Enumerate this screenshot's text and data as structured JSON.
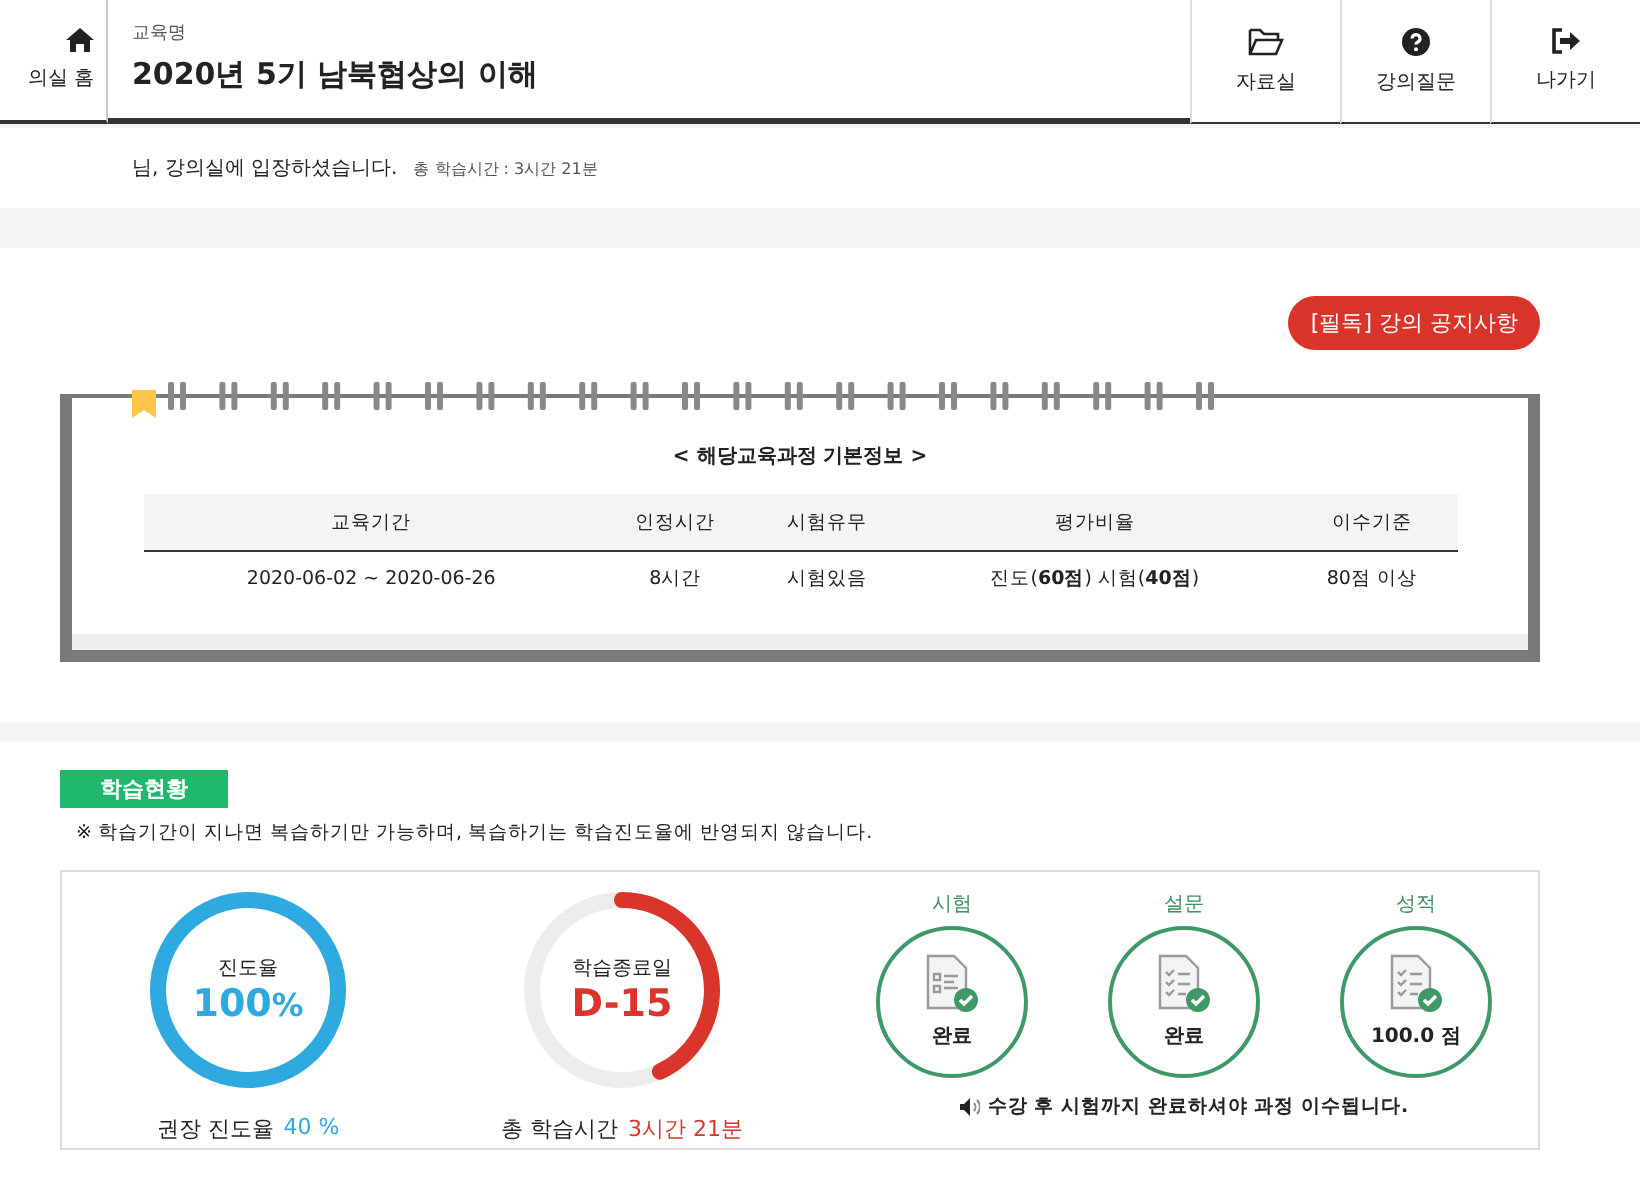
{
  "header": {
    "home": "의실 홈",
    "caption": "교육명",
    "title": "2020년 5기 남북협상의 이해",
    "actions": [
      {
        "kind": "folder",
        "label": "자료실"
      },
      {
        "kind": "question",
        "label": "강의질문"
      },
      {
        "kind": "exit",
        "label": "나가기"
      }
    ]
  },
  "welcome": {
    "message": "님, 강의실에 입장하셨습니다.",
    "time": "총 학습시간 : 3시간 21분"
  },
  "notice_button": "[필독] 강의 공지사항",
  "course_info": {
    "title": "< 해당교육과정 기본정보 >",
    "columns": [
      "교육기간",
      "인정시간",
      "시험유무",
      "평가비율",
      "이수기준"
    ],
    "rows": [
      [
        "2020-06-02 ~ 2020-06-26",
        "8시간",
        "시험있음",
        "진도(**60점**) 시험(**40점**)",
        "80점 이상"
      ]
    ]
  },
  "study": {
    "badge": "학습현황",
    "note": "※ 학습기간이 지나면 복습하기만 가능하며, 복습하기는 학습진도율에 반영되지 않습니다.",
    "progress": {
      "label": "진도율",
      "value": "100",
      "unit": "%",
      "level": 1,
      "caption": "권장 진도율",
      "caption_value": "40 %"
    },
    "end_date": {
      "label": "학습종료일",
      "value": "D-15",
      "level": 0.43,
      "caption": "총 학습시간",
      "caption_value": "3시간 21분"
    },
    "items": [
      {
        "kind": "exam",
        "title": "시험",
        "value": "완료"
      },
      {
        "kind": "survey",
        "title": "설문",
        "value": "완료"
      },
      {
        "kind": "grade",
        "title": "성적",
        "value": "100.0 점"
      }
    ],
    "footnote": "수강 후 시험까지 완료하셔야 과정 이수됩니다."
  }
}
